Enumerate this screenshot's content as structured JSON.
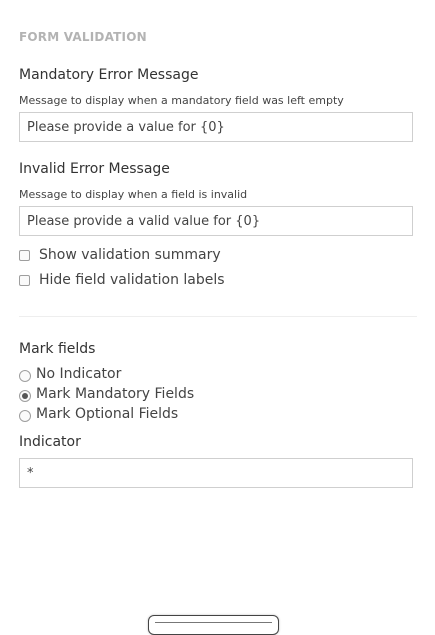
{
  "section": {
    "title": "FORM VALIDATION"
  },
  "mandatory": {
    "label": "Mandatory Error Message",
    "hint": "Message to display when a mandatory field was left empty",
    "value": "Please provide a value for {0}"
  },
  "invalid": {
    "label": "Invalid Error Message",
    "hint": "Message to display when a field is invalid",
    "value": "Please provide a valid value for {0}"
  },
  "options": {
    "show_summary": {
      "label": "Show validation summary",
      "checked": false
    },
    "hide_labels": {
      "label": "Hide field validation labels",
      "checked": false
    }
  },
  "mark_fields": {
    "label": "Mark fields",
    "options": [
      {
        "label": "No Indicator",
        "selected": false
      },
      {
        "label": "Mark Mandatory Fields",
        "selected": true
      },
      {
        "label": "Mark Optional Fields",
        "selected": false
      }
    ]
  },
  "indicator": {
    "label": "Indicator",
    "value": "*"
  }
}
